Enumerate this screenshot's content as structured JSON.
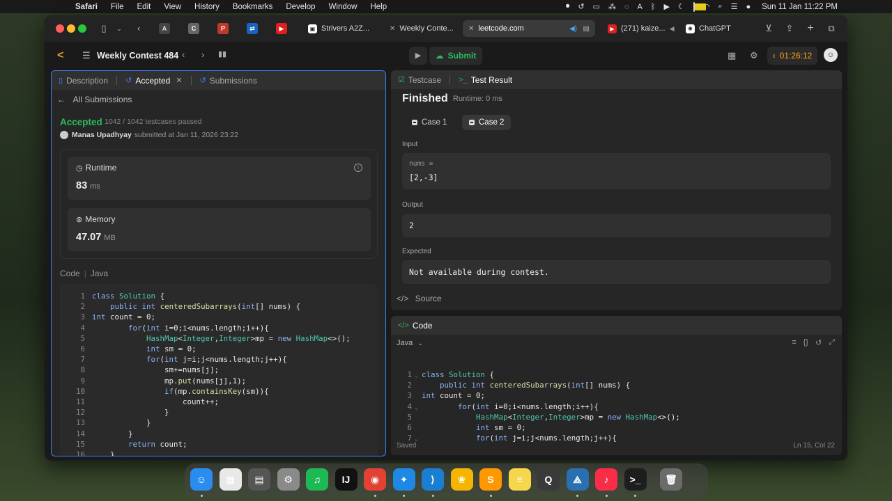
{
  "menubar": {
    "app_name": "Safari",
    "items": [
      "File",
      "Edit",
      "View",
      "History",
      "Bookmarks",
      "Develop",
      "Window",
      "Help"
    ],
    "clock": "Sun 11 Jan  11:22 PM"
  },
  "browser": {
    "tabs": [
      {
        "label": "Strivers A2Z...",
        "active": false
      },
      {
        "label": "Weekly Conte...",
        "active": false
      },
      {
        "label": "leetcode.com",
        "active": true
      },
      {
        "label": "(271) kaize...",
        "active": false
      },
      {
        "label": "ChatGPT",
        "active": false
      }
    ]
  },
  "header": {
    "contest_title": "Weekly Contest 484",
    "submit_label": "Submit",
    "timer": "01:26:12"
  },
  "left": {
    "tabs": {
      "description": "Description",
      "accepted": "Accepted",
      "submissions": "Submissions"
    },
    "back_link": "All Submissions",
    "status": "Accepted",
    "testcases": "1042 / 1042 testcases passed",
    "user": "Manas Upadhyay",
    "submitted_at": "submitted at Jan 11, 2026 23:22",
    "runtime": {
      "label": "Runtime",
      "value": "83",
      "unit": "ms"
    },
    "memory": {
      "label": "Memory",
      "value": "47.07",
      "unit": "MB"
    },
    "code_label": "Code",
    "language": "Java"
  },
  "code_left": [
    {
      "n": "1",
      "t": "class Solution {"
    },
    {
      "n": "2",
      "t": "    public int centeredSubarrays(int[] nums) {"
    },
    {
      "n": "3",
      "t": "int count = 0;"
    },
    {
      "n": "4",
      "t": "        for(int i=0;i<nums.length;i++){"
    },
    {
      "n": "5",
      "t": "            HashMap<Integer,Integer>mp = new HashMap<>();"
    },
    {
      "n": "6",
      "t": "            int sm = 0;"
    },
    {
      "n": "7",
      "t": "            for(int j=i;j<nums.length;j++){"
    },
    {
      "n": "8",
      "t": "                sm+=nums[j];"
    },
    {
      "n": "9",
      "t": "                mp.put(nums[j],1);"
    },
    {
      "n": "10",
      "t": "                if(mp.containsKey(sm)){"
    },
    {
      "n": "11",
      "t": "                    count++;"
    },
    {
      "n": "12",
      "t": "                }"
    },
    {
      "n": "13",
      "t": "            }"
    },
    {
      "n": "14",
      "t": "        }"
    },
    {
      "n": "15",
      "t": "        return count;"
    },
    {
      "n": "16",
      "t": "    }"
    }
  ],
  "result": {
    "tabs": {
      "testcase": "Testcase",
      "test_result": "Test Result"
    },
    "finished": "Finished",
    "runtime": "Runtime: 0 ms",
    "case1": "Case 1",
    "case2": "Case 2",
    "input_label": "Input",
    "input_var": "nums =",
    "input_value": "[2,-3]",
    "output_label": "Output",
    "output_value": "2",
    "expected_label": "Expected",
    "expected_value": "Not available during contest.",
    "source_label": "Source"
  },
  "editor": {
    "tab": "Code",
    "language": "Java",
    "status": "Saved",
    "cursor": "Ln 15, Col 22"
  },
  "code_right": [
    {
      "n": "1",
      "t": "class Solution {",
      "fold": true
    },
    {
      "n": "2",
      "t": "    public int centeredSubarrays(int[] nums) {",
      "fold": false
    },
    {
      "n": "3",
      "t": "int count = 0;",
      "fold": false
    },
    {
      "n": "4",
      "t": "        for(int i=0;i<nums.length;i++){",
      "fold": true
    },
    {
      "n": "5",
      "t": "            HashMap<Integer,Integer>mp = new HashMap<>();",
      "fold": false
    },
    {
      "n": "6",
      "t": "            int sm = 0;",
      "fold": false
    },
    {
      "n": "7",
      "t": "            for(int j=i;j<nums.length;j++){",
      "fold": true
    }
  ],
  "colors": {
    "accepted_green": "#2cbb5d",
    "timer_orange": "#ffa116",
    "focus_blue": "#3b82f6"
  },
  "dock": [
    {
      "name": "finder",
      "glyph": "☺",
      "color": "#2b8cf0"
    },
    {
      "name": "launchpad",
      "glyph": "▦",
      "color": "#e8e8e8"
    },
    {
      "name": "calculator",
      "glyph": "▤",
      "color": "#555555"
    },
    {
      "name": "system-settings",
      "glyph": "⚙",
      "color": "#8a8a8a"
    },
    {
      "name": "spotify",
      "glyph": "♫",
      "color": "#1db954"
    },
    {
      "name": "intellij",
      "glyph": "IJ",
      "color": "#111111"
    },
    {
      "name": "chrome",
      "glyph": "◉",
      "color": "#e34133"
    },
    {
      "name": "safari",
      "glyph": "✦",
      "color": "#1e88e5"
    },
    {
      "name": "vscode",
      "glyph": "⟩",
      "color": "#1a7fd1"
    },
    {
      "name": "photos",
      "glyph": "❀",
      "color": "#f4b400"
    },
    {
      "name": "sublime",
      "glyph": "S",
      "color": "#ff9800"
    },
    {
      "name": "notes",
      "glyph": "≡",
      "color": "#f5d64d"
    },
    {
      "name": "quicktime",
      "glyph": "Q",
      "color": "#3a3a3a"
    },
    {
      "name": "wireshark",
      "glyph": "⟁",
      "color": "#2a6fb0"
    },
    {
      "name": "music",
      "glyph": "♪",
      "color": "#fa2d48"
    },
    {
      "name": "terminal",
      "glyph": ">_",
      "color": "#1e1e1e"
    },
    {
      "name": "trash",
      "glyph": "🗑",
      "color": "#6b6b6b"
    }
  ]
}
